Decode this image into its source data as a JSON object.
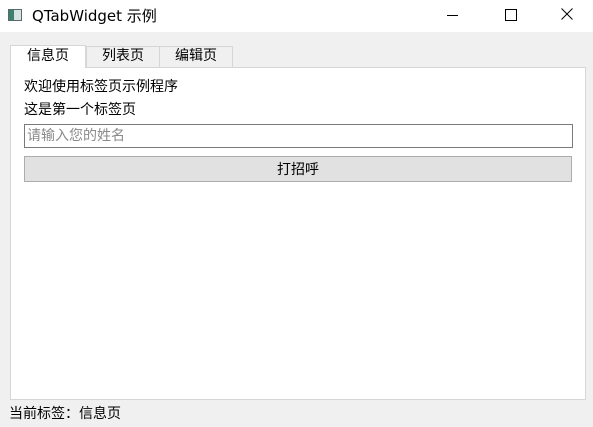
{
  "window": {
    "title": "QTabWidget 示例",
    "icon": "app-window-icon",
    "controls": {
      "minimize": "minimize-icon",
      "maximize": "maximize-icon",
      "close": "close-icon"
    }
  },
  "tabs": [
    {
      "label": "信息页",
      "active": true
    },
    {
      "label": "列表页",
      "active": false
    },
    {
      "label": "编辑页",
      "active": false
    }
  ],
  "info_page": {
    "welcome_text": "欢迎使用标签页示例程序",
    "first_tab_text": "这是第一个标签页",
    "name_input": {
      "value": "",
      "placeholder": "请输入您的姓名"
    },
    "greet_button_label": "打招呼"
  },
  "status": {
    "text": "当前标签：信息页"
  }
}
